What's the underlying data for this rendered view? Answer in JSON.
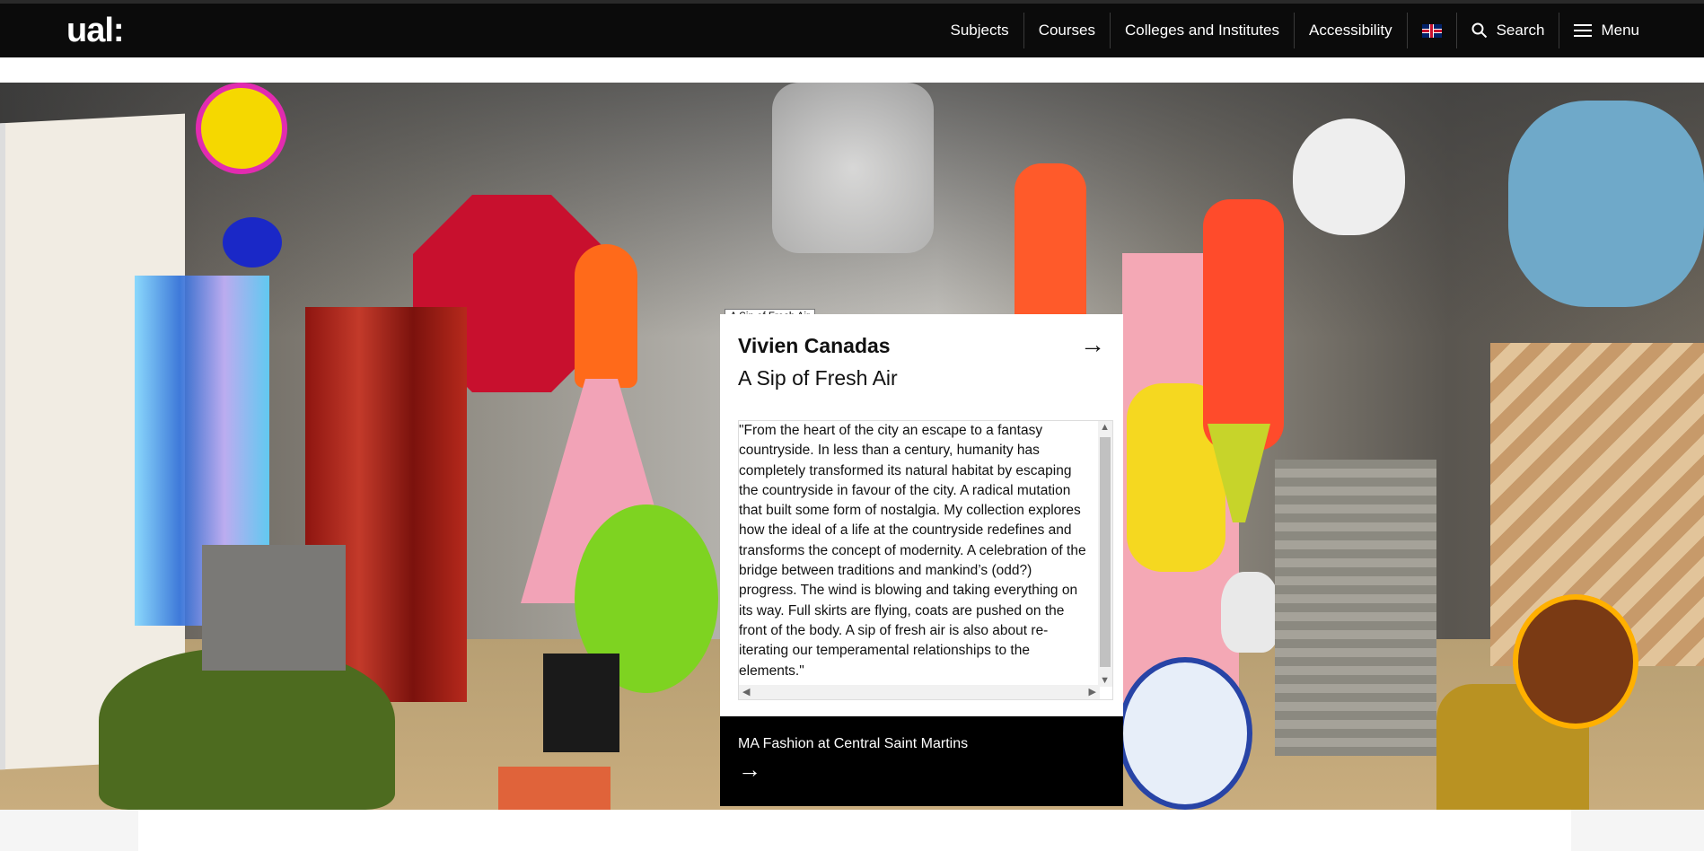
{
  "header": {
    "logo": "ual:",
    "nav": [
      {
        "label": "Subjects"
      },
      {
        "label": "Courses"
      },
      {
        "label": "Colleges and Institutes"
      },
      {
        "label": "Accessibility"
      }
    ],
    "language_flag_icon": "uk-flag-icon",
    "search_label": "Search",
    "menu_label": "Menu"
  },
  "hero": {
    "tooltip": "A Sip of Fresh Air",
    "card": {
      "designer": "Vivien Canadas",
      "title": "A Sip of Fresh Air",
      "quote": "\"From the heart of the city an escape to a fantasy countryside. In less than a century, humanity has completely transformed its natural habitat by escaping the countryside in favour of the city. A radical mutation that built some form of nostalgia. My collection explores how the ideal of a life at the countryside redefines and transforms the concept of modernity. A celebration of the bridge between traditions and mankind’s (odd?) progress. The wind is blowing and taking everything on its way. Full skirts are flying, coats are pushed on the front of the body. A sip of fresh air is also about re-iterating our temperamental relationships to the elements.\"",
      "footer_label": "MA Fashion at Central Saint Martins",
      "arrow": "→"
    }
  }
}
